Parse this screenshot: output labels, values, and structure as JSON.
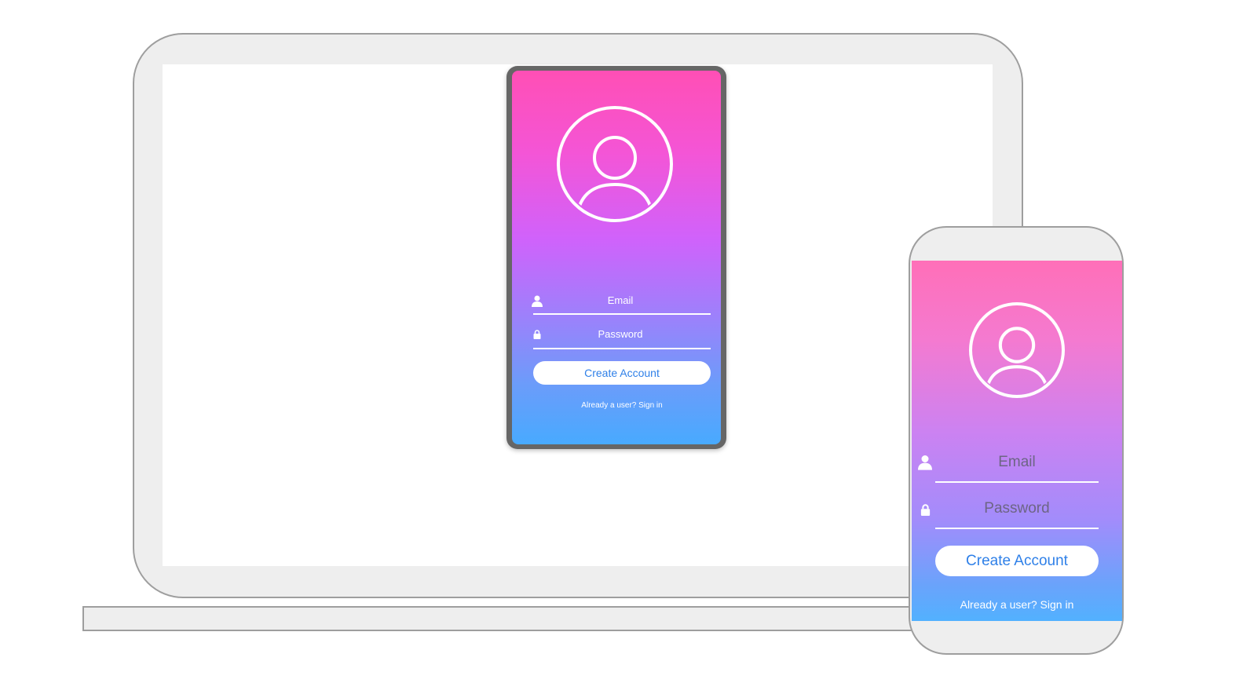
{
  "tablet_app": {
    "email_placeholder": "Email",
    "password_placeholder": "Password",
    "create_account_label": "Create Account",
    "signin_link": "Already a user? Sign in"
  },
  "phone_app": {
    "email_placeholder": "Email",
    "password_placeholder": "Password",
    "create_account_label": "Create Account",
    "signin_link": "Already a user? Sign in"
  },
  "icons": {
    "avatar": "user-avatar-icon",
    "email": "user-icon",
    "password": "lock-icon"
  },
  "colors": {
    "gradient_top": "#ff4fb5",
    "gradient_mid": "#d062fb",
    "gradient_bottom": "#48aaff",
    "button_text": "#2f80e8",
    "device_frame": "#eeeeee",
    "device_border": "#9e9e9e",
    "tablet_bezel": "#666666"
  }
}
